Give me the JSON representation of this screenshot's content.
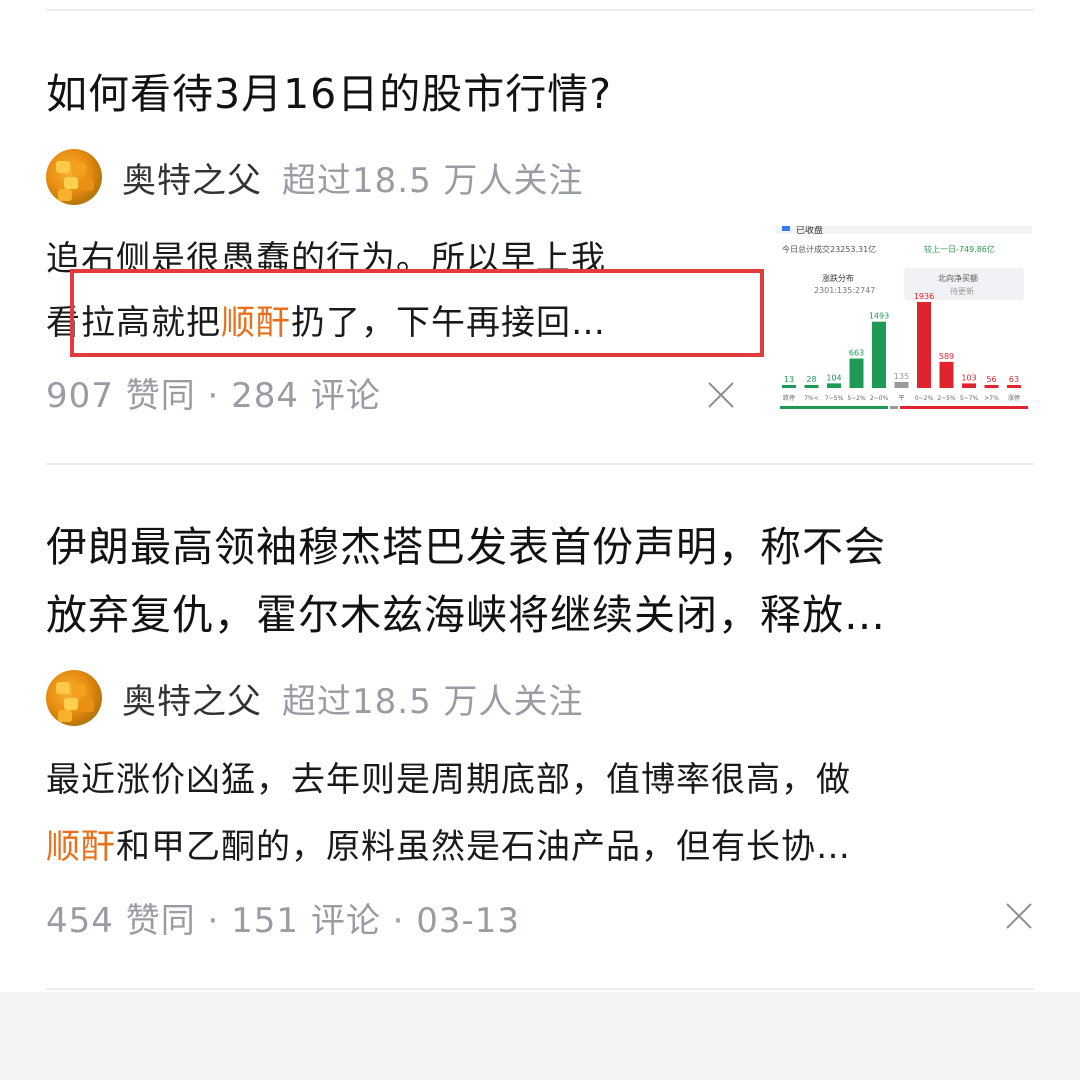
{
  "cards": [
    {
      "title": "如何看待3月16日的股市行情?",
      "author": "奥特之父",
      "followers": "超过18.5 万人关注",
      "excerpt_line1": "追右侧是很愚蠢的行为。所以早上我",
      "excerpt_line2_pre": "看拉高就把",
      "excerpt_line2_hl": "顺酐",
      "excerpt_line2_post": "扔了，下午再接回…",
      "meta": "907 赞同 · 284 评论",
      "thumbnail": {
        "header_title": "已收盘",
        "turnover_label": "今日总计成交23253.31亿",
        "compare_label": "较上一日-749.86亿",
        "tab_left": "涨跌分布",
        "tab_left_sub": "2301:135:2747",
        "tab_right": "北向净买额",
        "tab_right_sub": "待更新",
        "chart_data": {
          "type": "bar",
          "categories": [
            "跌停",
            "7%<",
            "7~5%",
            "5~2%",
            "2~0%",
            "平",
            "0~2%",
            "2~5%",
            "5~7%",
            ">7%",
            "涨停"
          ],
          "values": [
            13,
            28,
            104,
            663,
            1493,
            135,
            1936,
            589,
            103,
            56,
            63
          ],
          "colors": [
            "#1f9a55",
            "#1f9a55",
            "#1f9a55",
            "#1f9a55",
            "#1f9a55",
            "#9a9a9a",
            "#e0232e",
            "#e0232e",
            "#e0232e",
            "#e0232e",
            "#e0232e"
          ]
        }
      }
    },
    {
      "title_line1": "伊朗最高领袖穆杰塔巴发表首份声明，称不会",
      "title_line2": "放弃复仇，霍尔木兹海峡将继续关闭，释放…",
      "author": "奥特之父",
      "followers": "超过18.5 万人关注",
      "excerpt_line1": "最近涨价凶猛，去年则是周期底部，值博率很高，做",
      "excerpt_line2_hl": "顺酐",
      "excerpt_line2_post": "和甲乙酮的，原料虽然是石油产品，但有长协…",
      "meta": "454 赞同 · 151 评论 · 03-13"
    }
  ],
  "icons": {
    "close": "close-icon",
    "avatar": "avatar"
  },
  "colors": {
    "highlight": "#e8701b",
    "box": "#e23b3b",
    "muted": "#9a9ca3"
  }
}
